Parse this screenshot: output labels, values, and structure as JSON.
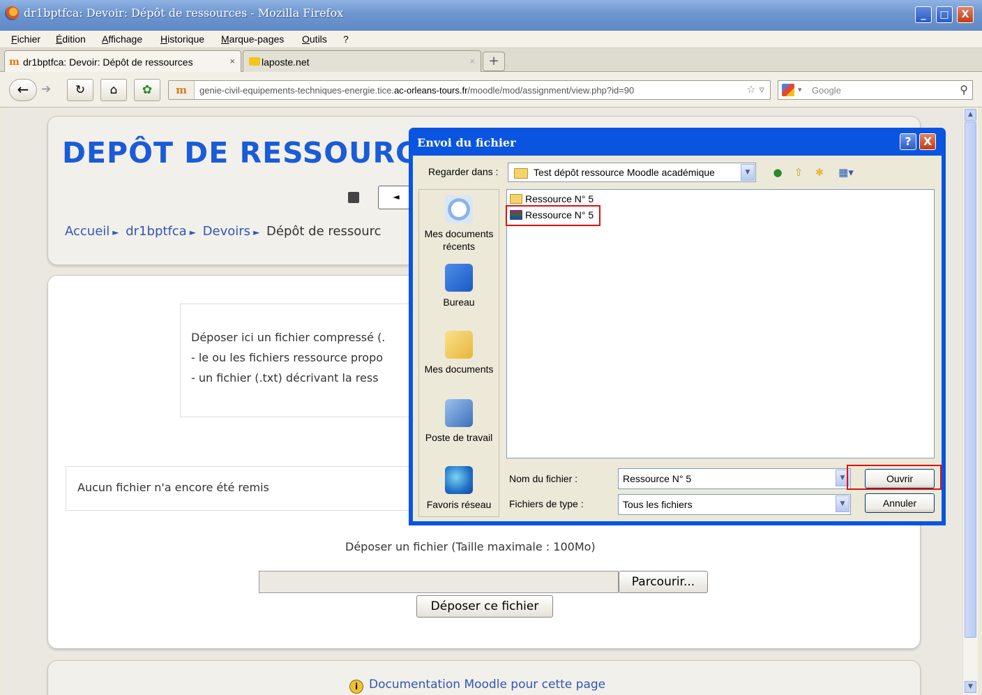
{
  "window": {
    "title": "dr1bptfca: Devoir: Dépôt de ressources - Mozilla Firefox",
    "minimize": "_",
    "maximize": "□",
    "close": "X"
  },
  "menu": [
    "Fichier",
    "Édition",
    "Affichage",
    "Historique",
    "Marque-pages",
    "Outils",
    "?"
  ],
  "tabs": [
    {
      "label": "dr1bptfca: Devoir: Dépôt de ressources",
      "close": "×",
      "icon": "moodle-icon"
    },
    {
      "label": "laposte.net",
      "close": "×",
      "icon": "laposte-icon"
    }
  ],
  "new_tab": "+",
  "nav": {
    "url_prefix": "genie-civil-equipements-techniques-energie.tice.",
    "url_domain": "ac-orleans-tours.fr",
    "url_path": "/moodle/mod/assignment/view.php?id=90",
    "site_badge": "m",
    "search_placeholder": "Google"
  },
  "page": {
    "heading": "DEPÔT DE RESSOURC",
    "prev_label": "◄",
    "breadcrumb": [
      "Accueil",
      "dr1bptfca",
      "Devoirs",
      "Dépôt de ressourc"
    ],
    "breadcrumb_sep": "►",
    "intro_lines": [
      "Déposer ici un fichier compressé (.",
      "- le ou les fichiers ressource propo",
      "- un fichier (.txt) décrivant la ress"
    ],
    "no_file_text": "Aucun fichier n'a encore été remis",
    "upload_title": "Déposer un fichier (Taille maximale : 100Mo)",
    "browse_label": "Parcourir...",
    "submit_label": "Déposer ce fichier",
    "doc_link": "Documentation Moodle pour cette page",
    "info_glyph": "i"
  },
  "dialog": {
    "title": "Envoi du fichier",
    "help": "?",
    "close": "X",
    "look_in_label": "Regarder dans :",
    "look_in_value": "Test dépôt ressource Moodle académique",
    "places": [
      "Mes documents récents",
      "Bureau",
      "Mes documents",
      "Poste de travail",
      "Favoris réseau"
    ],
    "files": [
      {
        "name": "Ressource N° 5",
        "type": "folder"
      },
      {
        "name": "Ressource N° 5",
        "type": "rar-archive"
      }
    ],
    "filename_label": "Nom du fichier :",
    "filename_value": "Ressource N° 5",
    "filetype_label": "Fichiers de type :",
    "filetype_value": "Tous les fichiers",
    "open_label": "Ouvrir",
    "cancel_label": "Annuler",
    "highlight_color": "#e01010"
  }
}
